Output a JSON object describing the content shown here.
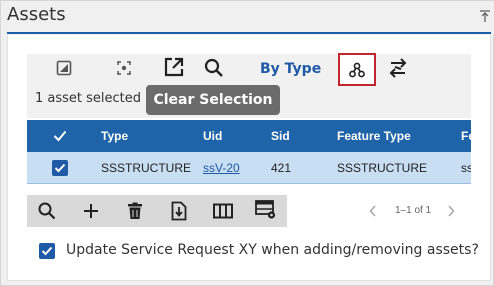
{
  "panel": {
    "title": "Assets"
  },
  "toolbar": {
    "by_type_label": "By Type",
    "selected_text": "1 asset selected",
    "clear_selection_label": "Clear Selection"
  },
  "grid": {
    "columns": [
      "Type",
      "Uid",
      "Sid",
      "Feature Type",
      "Fe"
    ],
    "rows": [
      {
        "type": "SSSTRUCTURE",
        "uid": "ssV-20",
        "sid": "421",
        "feature_type": "SSSTRUCTURE",
        "fe": "ss"
      }
    ]
  },
  "pager": {
    "text": "1–1 of 1"
  },
  "footer": {
    "checkbox_label": "Update Service Request XY when adding/removing assets?"
  },
  "colors": {
    "accent": "#1f64a8",
    "selected_row": "#c8def3",
    "highlight_border": "#c0262d"
  }
}
